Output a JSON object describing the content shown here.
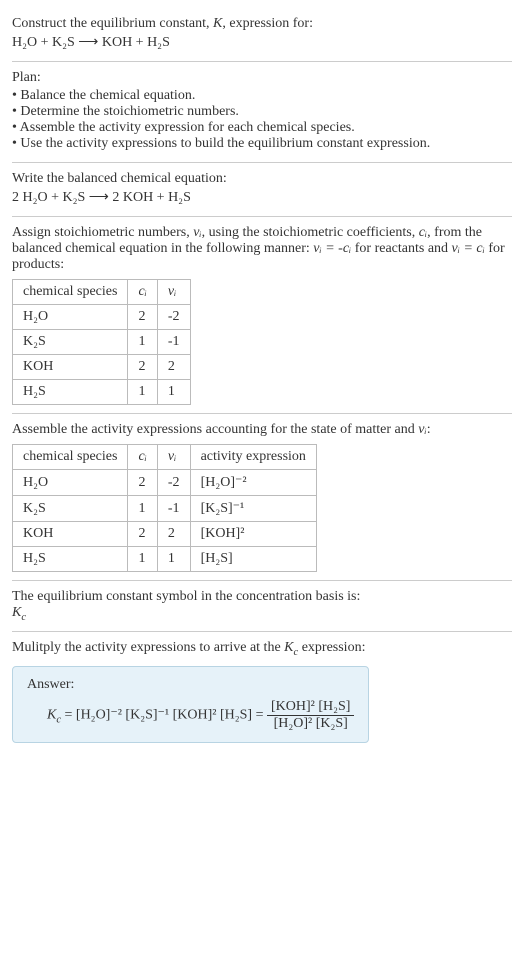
{
  "header": {
    "prompt_text": "Construct the equilibrium constant, ",
    "prompt_symbol": "K",
    "prompt_text2": ", expression for:",
    "equation_unbalanced": "H₂O + K₂S ⟶ KOH + H₂S"
  },
  "plan": {
    "title": "Plan:",
    "items": [
      "Balance the chemical equation.",
      "Determine the stoichiometric numbers.",
      "Assemble the activity expression for each chemical species.",
      "Use the activity expressions to build the equilibrium constant expression."
    ]
  },
  "balanced": {
    "title": "Write the balanced chemical equation:",
    "equation": "2 H₂O + K₂S ⟶ 2 KOH + H₂S"
  },
  "stoich": {
    "intro1": "Assign stoichiometric numbers, ",
    "nu": "νᵢ",
    "intro2": ", using the stoichiometric coefficients, ",
    "ci": "cᵢ",
    "intro3": ", from the balanced chemical equation in the following manner: ",
    "rel_reactants": "νᵢ = -cᵢ",
    "intro4": " for reactants and ",
    "rel_products": "νᵢ = cᵢ",
    "intro5": " for products:",
    "table": {
      "headers": {
        "species": "chemical species",
        "ci": "cᵢ",
        "nu": "νᵢ"
      },
      "rows": [
        {
          "species": "H₂O",
          "ci": "2",
          "nu": "-2"
        },
        {
          "species": "K₂S",
          "ci": "1",
          "nu": "-1"
        },
        {
          "species": "KOH",
          "ci": "2",
          "nu": "2"
        },
        {
          "species": "H₂S",
          "ci": "1",
          "nu": "1"
        }
      ]
    }
  },
  "activity": {
    "intro1": "Assemble the activity expressions accounting for the state of matter and ",
    "nu": "νᵢ",
    "intro2": ":",
    "table": {
      "headers": {
        "species": "chemical species",
        "ci": "cᵢ",
        "nu": "νᵢ",
        "act": "activity expression"
      },
      "rows": [
        {
          "species": "H₂O",
          "ci": "2",
          "nu": "-2",
          "act": "[H₂O]⁻²"
        },
        {
          "species": "K₂S",
          "ci": "1",
          "nu": "-1",
          "act": "[K₂S]⁻¹"
        },
        {
          "species": "KOH",
          "ci": "2",
          "nu": "2",
          "act": "[KOH]²"
        },
        {
          "species": "H₂S",
          "ci": "1",
          "nu": "1",
          "act": "[H₂S]"
        }
      ]
    }
  },
  "symbol": {
    "text": "The equilibrium constant symbol in the concentration basis is:",
    "kc": "K",
    "kc_sub": "c"
  },
  "multiply": {
    "text1": "Mulitply the activity expressions to arrive at the ",
    "kc": "K",
    "kc_sub": "c",
    "text2": " expression:"
  },
  "answer": {
    "label": "Answer:",
    "kc": "K",
    "kc_sub": "c",
    "eq": " = [H₂O]⁻² [K₂S]⁻¹ [KOH]² [H₂S] = ",
    "num": "[KOH]² [H₂S]",
    "den": "[H₂O]² [K₂S]"
  },
  "chart_data": {
    "type": "table",
    "tables": [
      {
        "title": "Stoichiometric numbers",
        "columns": [
          "chemical species",
          "cᵢ",
          "νᵢ"
        ],
        "rows": [
          [
            "H₂O",
            2,
            -2
          ],
          [
            "K₂S",
            1,
            -1
          ],
          [
            "KOH",
            2,
            2
          ],
          [
            "H₂S",
            1,
            1
          ]
        ]
      },
      {
        "title": "Activity expressions",
        "columns": [
          "chemical species",
          "cᵢ",
          "νᵢ",
          "activity expression"
        ],
        "rows": [
          [
            "H₂O",
            2,
            -2,
            "[H₂O]⁻²"
          ],
          [
            "K₂S",
            1,
            -1,
            "[K₂S]⁻¹"
          ],
          [
            "KOH",
            2,
            2,
            "[KOH]²"
          ],
          [
            "H₂S",
            1,
            1,
            "[H₂S]"
          ]
        ]
      }
    ]
  }
}
